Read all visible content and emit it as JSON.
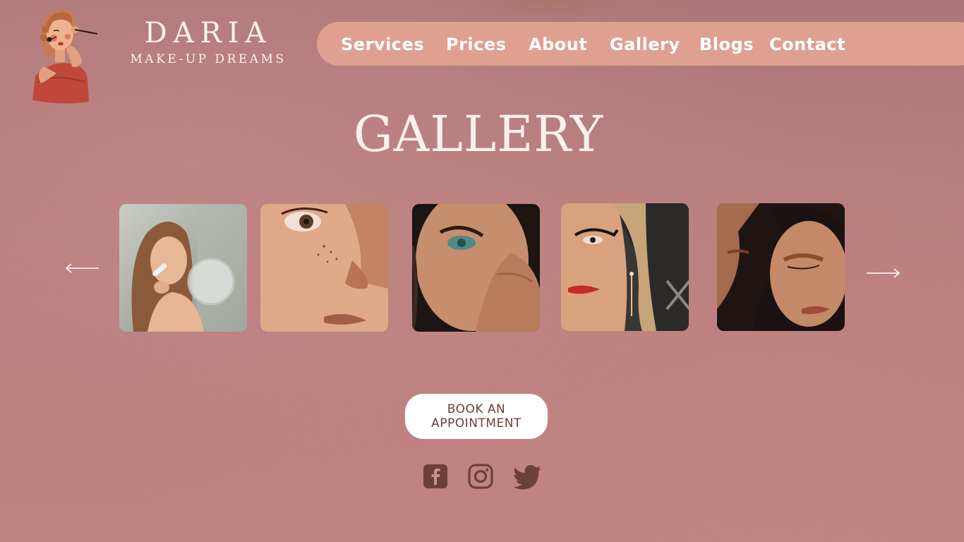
{
  "brand": {
    "name": "DARIA",
    "tagline": "MAKE-UP DREAMS"
  },
  "nav": {
    "items": [
      {
        "label": "Services"
      },
      {
        "label": "Prices"
      },
      {
        "label": "About"
      },
      {
        "label": "Gallery"
      },
      {
        "label": "Blogs"
      },
      {
        "label": "Contact"
      }
    ]
  },
  "page": {
    "title": "GALLERY"
  },
  "gallery": {
    "photos": [
      {
        "subject": "woman-applying-blush-with-mirror"
      },
      {
        "subject": "freckled-face-closeup"
      },
      {
        "subject": "teal-eyeshadow-portrait"
      },
      {
        "subject": "graphic-eyeliner-portrait"
      },
      {
        "subject": "two-women-bronze-makeup"
      }
    ]
  },
  "cta": {
    "line1": "BOOK AN",
    "line2": "APPOINTMENT"
  },
  "social": {
    "icons": [
      "facebook-icon",
      "instagram-icon",
      "twitter-icon"
    ]
  },
  "colors": {
    "background": "#b87e7e",
    "nav_pill": "#e0a08f",
    "heading_text": "#fbf1ec",
    "button_bg": "#ffffff",
    "button_text": "#6b4039",
    "social_icons": "#6b4039"
  }
}
